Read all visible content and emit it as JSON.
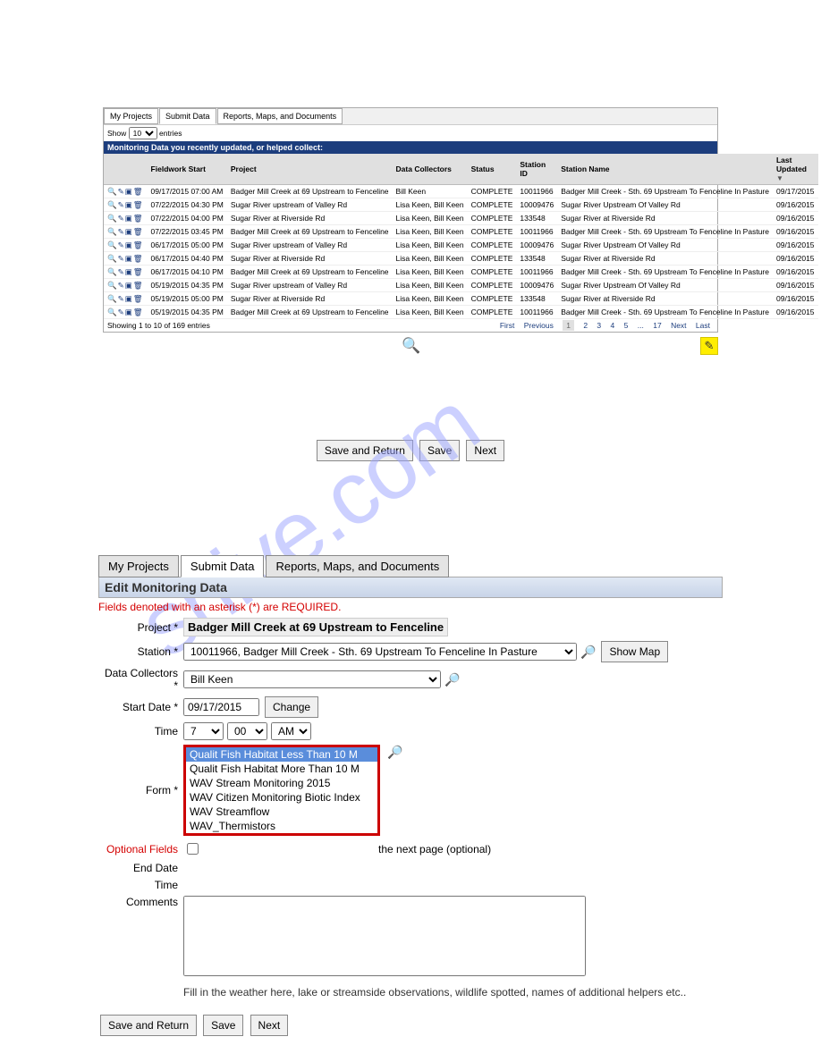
{
  "tabsTop": {
    "t1": "My Projects",
    "t2": "Submit Data",
    "t3": "Reports, Maps, and Documents"
  },
  "showEntries": {
    "pre": "Show",
    "val": "10",
    "post": "entries"
  },
  "tableHeader": "Monitoring Data you recently updated, or helped collect:",
  "columns": {
    "fs": "Fieldwork Start",
    "proj": "Project",
    "dc": "Data Collectors",
    "status": "Status",
    "sid": "Station ID",
    "sname": "Station Name",
    "lu": "Last Updated"
  },
  "rows": [
    {
      "fs": "09/17/2015 07:00 AM",
      "proj": "Badger Mill Creek at 69 Upstream to Fenceline",
      "dc": "Bill Keen",
      "status": "COMPLETE",
      "sid": "10011966",
      "sname": "Badger Mill Creek - Sth. 69 Upstream To Fenceline In Pasture",
      "lu": "09/17/2015"
    },
    {
      "fs": "07/22/2015 04:30 PM",
      "proj": "Sugar River upstream of Valley Rd",
      "dc": "Lisa Keen, Bill Keen",
      "status": "COMPLETE",
      "sid": "10009476",
      "sname": "Sugar River Upstream Of Valley Rd",
      "lu": "09/16/2015"
    },
    {
      "fs": "07/22/2015 04:00 PM",
      "proj": "Sugar River at Riverside Rd",
      "dc": "Lisa Keen, Bill Keen",
      "status": "COMPLETE",
      "sid": "133548",
      "sname": "Sugar River at Riverside Rd",
      "lu": "09/16/2015"
    },
    {
      "fs": "07/22/2015 03:45 PM",
      "proj": "Badger Mill Creek at 69 Upstream to Fenceline",
      "dc": "Lisa Keen, Bill Keen",
      "status": "COMPLETE",
      "sid": "10011966",
      "sname": "Badger Mill Creek - Sth. 69 Upstream To Fenceline In Pasture",
      "lu": "09/16/2015"
    },
    {
      "fs": "06/17/2015 05:00 PM",
      "proj": "Sugar River upstream of Valley Rd",
      "dc": "Lisa Keen, Bill Keen",
      "status": "COMPLETE",
      "sid": "10009476",
      "sname": "Sugar River Upstream Of Valley Rd",
      "lu": "09/16/2015"
    },
    {
      "fs": "06/17/2015 04:40 PM",
      "proj": "Sugar River at Riverside Rd",
      "dc": "Lisa Keen, Bill Keen",
      "status": "COMPLETE",
      "sid": "133548",
      "sname": "Sugar River at Riverside Rd",
      "lu": "09/16/2015"
    },
    {
      "fs": "06/17/2015 04:10 PM",
      "proj": "Badger Mill Creek at 69 Upstream to Fenceline",
      "dc": "Lisa Keen, Bill Keen",
      "status": "COMPLETE",
      "sid": "10011966",
      "sname": "Badger Mill Creek - Sth. 69 Upstream To Fenceline In Pasture",
      "lu": "09/16/2015"
    },
    {
      "fs": "05/19/2015 04:35 PM",
      "proj": "Sugar River upstream of Valley Rd",
      "dc": "Lisa Keen, Bill Keen",
      "status": "COMPLETE",
      "sid": "10009476",
      "sname": "Sugar River Upstream Of Valley Rd",
      "lu": "09/16/2015"
    },
    {
      "fs": "05/19/2015 05:00 PM",
      "proj": "Sugar River at Riverside Rd",
      "dc": "Lisa Keen, Bill Keen",
      "status": "COMPLETE",
      "sid": "133548",
      "sname": "Sugar River at Riverside Rd",
      "lu": "09/16/2015"
    },
    {
      "fs": "05/19/2015 04:35 PM",
      "proj": "Badger Mill Creek at 69 Upstream to Fenceline",
      "dc": "Lisa Keen, Bill Keen",
      "status": "COMPLETE",
      "sid": "10011966",
      "sname": "Badger Mill Creek - Sth. 69 Upstream To Fenceline In Pasture",
      "lu": "09/16/2015"
    }
  ],
  "footer": {
    "showing": "Showing 1 to 10 of 169 entries"
  },
  "pager": {
    "first": "First",
    "prev": "Previous",
    "p1": "1",
    "p2": "2",
    "p3": "3",
    "p4": "4",
    "p5": "5",
    "dots": "...",
    "pLast": "17",
    "next": "Next",
    "last": "Last"
  },
  "midBtns": {
    "save_return": "Save and Return",
    "save": "Save",
    "next": "Next"
  },
  "tabsBottom": {
    "t1": "My Projects",
    "t2": "Submit Data",
    "t3": "Reports, Maps, and Documents"
  },
  "form": {
    "title": "Edit Monitoring Data",
    "required_note": "Fields denoted with an asterisk (*) are REQUIRED.",
    "labels": {
      "project": "Project *",
      "station": "Station *",
      "collectors": "Data Collectors *",
      "start": "Start Date *",
      "time1": "Time",
      "form": "Form *",
      "optional": "Optional Fields",
      "end": "End Date",
      "time2": "Time",
      "comments": "Comments"
    },
    "project_name": "Badger Mill Creek at 69 Upstream to Fenceline",
    "station_value": "10011966, Badger Mill Creek - Sth. 69 Upstream To Fenceline In Pasture",
    "show_map": "Show Map",
    "collector_value": "Bill Keen",
    "start_date": "09/17/2015",
    "change": "Change",
    "hour": "7",
    "min": "00",
    "ampm": "AM",
    "form_options": [
      "Qualit Fish Habitat Less Than 10 M",
      "Qualit Fish Habitat More Than 10 M",
      "WAV Stream Monitoring 2015",
      "WAV Citizen Monitoring Biotic Index",
      "WAV Streamflow",
      "WAV_Thermistors"
    ],
    "opt_check_tail": "the next page (optional)",
    "help": "Fill in the weather here, lake or streamside observations, wildlife spotted, names of additional helpers etc.."
  },
  "watermark": "shive.com"
}
